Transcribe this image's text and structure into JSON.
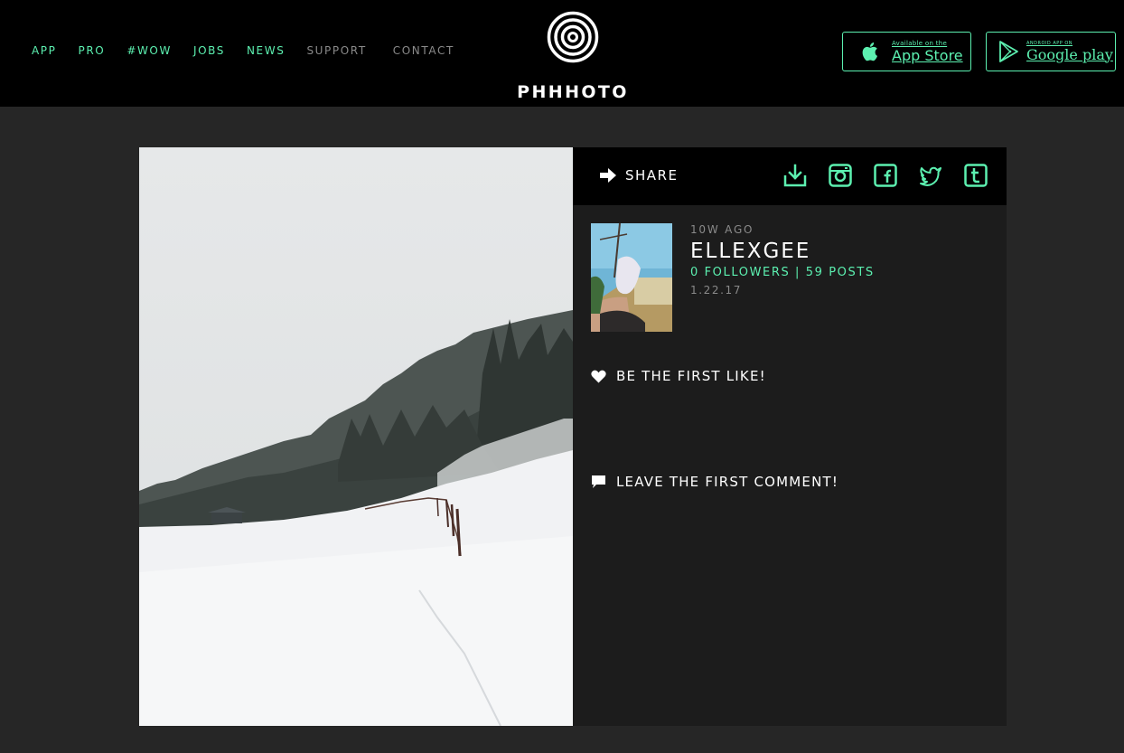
{
  "nav": {
    "items": [
      {
        "label": "APP",
        "color": "#5cf0b0"
      },
      {
        "label": "PRO",
        "color": "#5cf0b0"
      },
      {
        "label": "#WOW",
        "color": "#5cf0b0"
      },
      {
        "label": "JOBS",
        "color": "#5cf0b0"
      },
      {
        "label": "NEWS",
        "color": "#5cf0b0"
      },
      {
        "label": "SUPPORT",
        "color": "#8a8a8a"
      },
      {
        "label": "CONTACT",
        "color": "#8a8a8a"
      }
    ]
  },
  "logo": {
    "text": "PHHHOTO",
    "icon": "concentric-circles-icon"
  },
  "stores": {
    "apple": {
      "small": "Available on the",
      "big": "App Store",
      "icon": "apple-icon"
    },
    "google": {
      "small": "ANDROID APP ON",
      "big": "Google play",
      "icon": "google-play-icon"
    }
  },
  "share": {
    "label": "SHARE",
    "icons": [
      "download-icon",
      "instagram-icon",
      "facebook-icon",
      "twitter-icon",
      "tumblr-icon"
    ]
  },
  "post": {
    "time_ago": "10W AGO",
    "username": "ELLEXGEE",
    "stats": "0 FOLLOWERS | 59 POSTS",
    "date": "1.22.17",
    "likes_label": "BE THE FIRST LIKE!",
    "comments_label": "LEAVE THE FIRST COMMENT!"
  },
  "colors": {
    "accent": "#5cf0b0",
    "header_bg": "#000000",
    "page_bg": "#262626",
    "panel_bg": "#1c1c1c"
  }
}
